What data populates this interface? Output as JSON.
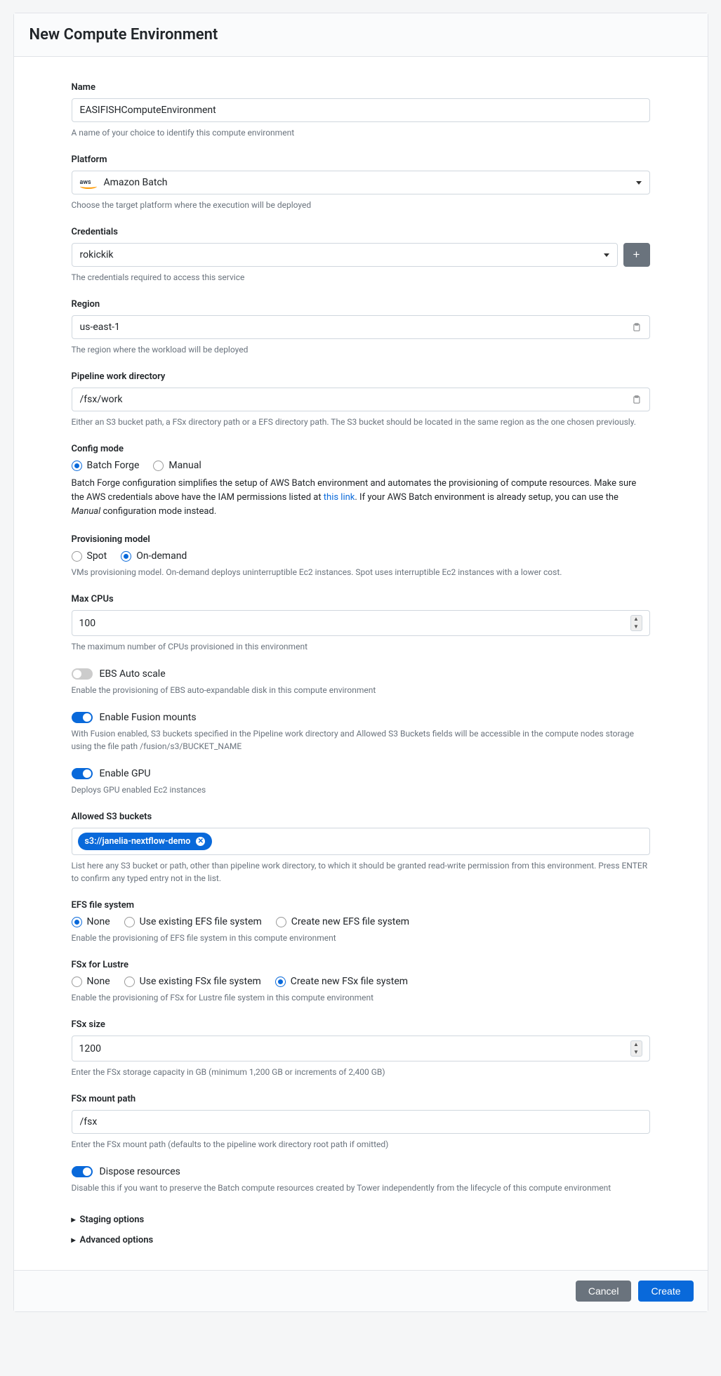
{
  "header": {
    "title": "New Compute Environment"
  },
  "name": {
    "label": "Name",
    "value": "EASIFISHComputeEnvironment",
    "help": "A name of your choice to identify this compute environment"
  },
  "platform": {
    "label": "Platform",
    "value": "Amazon Batch",
    "logo": "aws",
    "help": "Choose the target platform where the execution will be deployed"
  },
  "credentials": {
    "label": "Credentials",
    "value": "rokickik",
    "help": "The credentials required to access this service",
    "addIconName": "plus-icon"
  },
  "region": {
    "label": "Region",
    "value": "us-east-1",
    "help": "The region where the workload will be deployed"
  },
  "workdir": {
    "label": "Pipeline work directory",
    "value": "/fsx/work",
    "help": "Either an S3 bucket path, a FSx directory path or a EFS directory path. The S3 bucket should be located in the same region as the one chosen previously."
  },
  "configMode": {
    "label": "Config mode",
    "options": [
      "Batch Forge",
      "Manual"
    ],
    "selected": "Batch Forge",
    "desc1": "Batch Forge configuration simplifies the setup of AWS Batch environment and automates the provisioning of compute resources. Make sure the AWS credentials above have the IAM permissions listed at ",
    "link": "this link",
    "desc2": ". If your AWS Batch environment is already setup, you can use the ",
    "em": "Manual",
    "desc3": " configuration mode instead."
  },
  "provisioning": {
    "label": "Provisioning model",
    "options": [
      "Spot",
      "On-demand"
    ],
    "selected": "On-demand",
    "help": "VMs provisioning model. On-demand deploys uninterruptible Ec2 instances. Spot uses interruptible Ec2 instances with a lower cost."
  },
  "maxCpus": {
    "label": "Max CPUs",
    "value": "100",
    "help": "The maximum number of CPUs provisioned in this environment"
  },
  "ebs": {
    "label": "EBS Auto scale",
    "on": false,
    "help": "Enable the provisioning of EBS auto-expandable disk in this compute environment"
  },
  "fusion": {
    "label": "Enable Fusion mounts",
    "on": true,
    "help": "With Fusion enabled, S3 buckets specified in the Pipeline work directory and Allowed S3 Buckets fields will be accessible in the compute nodes storage using the file path /fusion/s3/BUCKET_NAME"
  },
  "gpu": {
    "label": "Enable GPU",
    "on": true,
    "help": "Deploys GPU enabled Ec2 instances"
  },
  "s3buckets": {
    "label": "Allowed S3 buckets",
    "chips": [
      "s3://janelia-nextflow-demo"
    ],
    "help": "List here any S3 bucket or path, other than pipeline work directory, to which it should be granted read-write permission from this environment. Press ENTER to confirm any typed entry not in the list."
  },
  "efs": {
    "label": "EFS file system",
    "options": [
      "None",
      "Use existing EFS file system",
      "Create new EFS file system"
    ],
    "selected": "None",
    "help": "Enable the provisioning of EFS file system in this compute environment"
  },
  "fsx": {
    "label": "FSx for Lustre",
    "options": [
      "None",
      "Use existing FSx file system",
      "Create new FSx file system"
    ],
    "selected": "Create new FSx file system",
    "help": "Enable the provisioning of FSx for Lustre file system in this compute environment"
  },
  "fsxSize": {
    "label": "FSx size",
    "value": "1200",
    "help": "Enter the FSx storage capacity in GB (minimum 1,200 GB or increments of 2,400 GB)"
  },
  "fsxMount": {
    "label": "FSx mount path",
    "value": "/fsx",
    "help": "Enter the FSx mount path (defaults to the pipeline work directory root path if omitted)"
  },
  "dispose": {
    "label": "Dispose resources",
    "on": true,
    "help": "Disable this if you want to preserve the Batch compute resources created by Tower independently from the lifecycle of this compute environment"
  },
  "collapsibles": {
    "staging": "Staging options",
    "advanced": "Advanced options"
  },
  "footer": {
    "cancel": "Cancel",
    "create": "Create"
  }
}
